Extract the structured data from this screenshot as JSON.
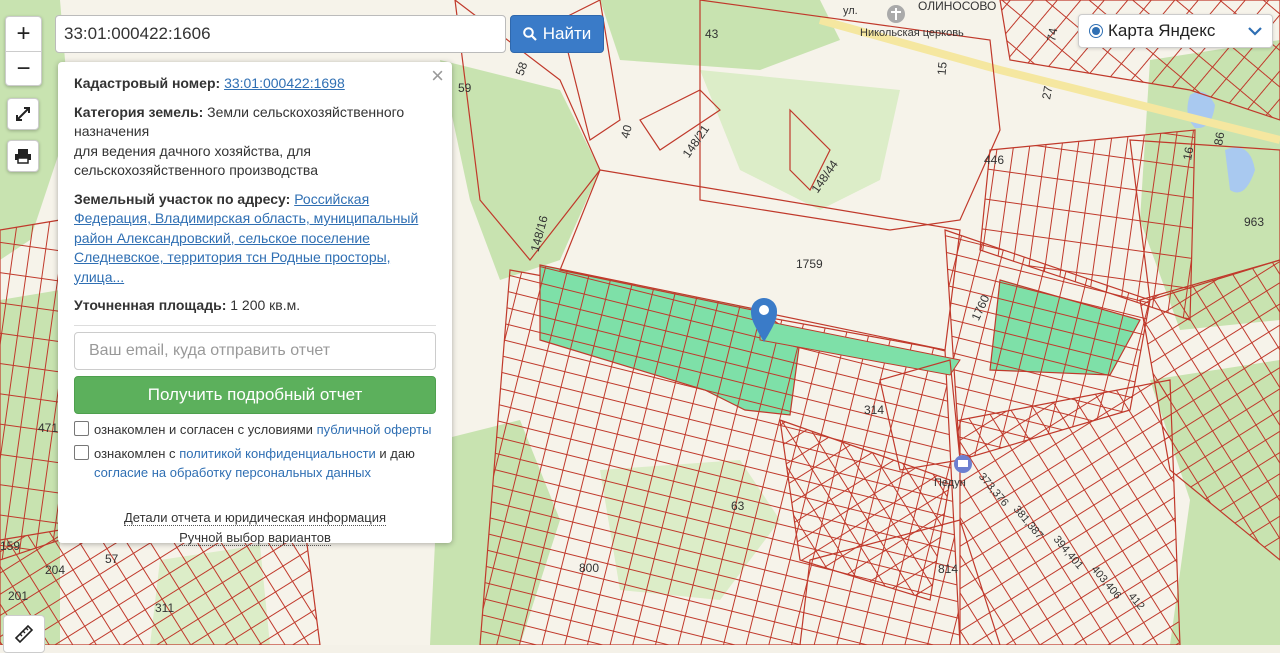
{
  "search": {
    "value": "33:01:000422:1606",
    "button_label": "Найти"
  },
  "zoom": {
    "in_label": "+",
    "out_label": "−"
  },
  "controls": {
    "fullscreen_icon": "fullscreen-icon",
    "print_icon": "printer-icon",
    "ruler_icon": "ruler-icon"
  },
  "layer": {
    "selected": "Карта Яндекс"
  },
  "map": {
    "labels": {
      "place_top": "ОЛИНОСОВО",
      "church": "Никольская церковь",
      "street": "ул.",
      "n43": "43",
      "n58": "58",
      "n59": "59",
      "n40": "40",
      "n15": "15",
      "n74": "74",
      "n27": "27",
      "n148_21": "148/21",
      "n148_44": "148/44",
      "n148_16": "148/16",
      "n446": "446",
      "n16": "16",
      "n86": "86",
      "n963": "963",
      "n1759": "1759",
      "n1760": "1760",
      "n314": "314",
      "n63": "63",
      "n800": "800",
      "n814": "814",
      "n471": "471",
      "n159": "159",
      "n204": "204",
      "n57": "57",
      "n201": "201",
      "n311": "311",
      "stop": "Педун",
      "n373": "373,376",
      "n381": "381,387",
      "n394": "394,401",
      "n403": "403,406",
      "n412": "412"
    },
    "colors": {
      "parcel_line": "#c0392b",
      "forest": "#c8e3b0",
      "field": "#f6f3ea",
      "selected_fill": "#7ee0a8",
      "marker": "#3a7bc8"
    }
  },
  "panel": {
    "cadastral_label": "Кадастровый номер:",
    "cadastral_value": "33:01:000422:1698",
    "category_label": "Категория земель:",
    "category_value": "Земли сельскохозяйственного назначения",
    "use_value": "для ведения дачного хозяйства, для сельскохозяйственного производства",
    "address_label": "Земельный участок по адресу:",
    "address_value": "Российская Федерация, Владимирская область, муниципальный район Александровский, сельское поселение Следневское, территория тсн Родные просторы, улица...",
    "area_label": "Уточненная площадь:",
    "area_value": "1 200 кв.м.",
    "email_placeholder": "Ваш email, куда отправить отчет",
    "report_button": "Получить подробный отчет",
    "consent1_text": "ознакомлен и согласен с условиями ",
    "consent1_link": "публичной оферты",
    "consent2_text1": "ознакомлен с ",
    "consent2_link1": "политикой конфиденциальности",
    "consent2_text2": " и даю ",
    "consent2_link2": "согласие на обработку персональных данных",
    "details_link": "Детали отчета и юридическая информация",
    "manual_link": "Ручной выбор вариантов",
    "close": "×"
  }
}
